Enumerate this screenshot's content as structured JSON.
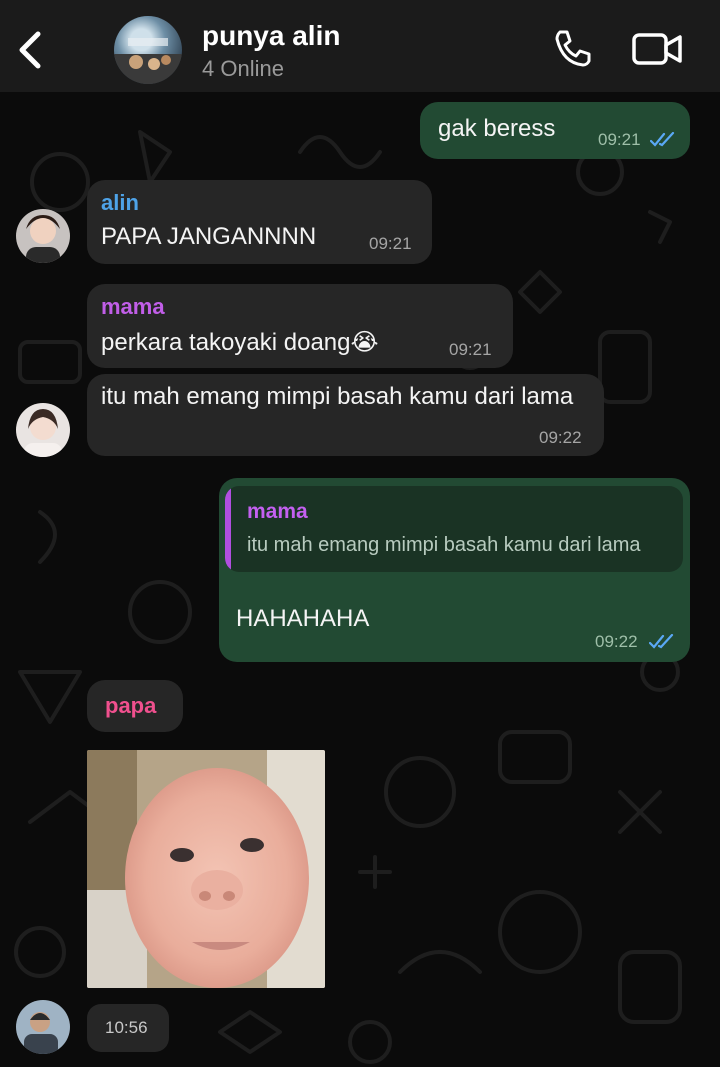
{
  "header": {
    "back_icon": "chevron-left-icon",
    "title": "punya alin",
    "status": "4 Online",
    "call_icon": "phone-icon",
    "video_icon": "video-camera-icon"
  },
  "colors": {
    "outgoing_bubble": "#224a33",
    "incoming_bubble": "#262626",
    "name_alin": "#4ea3e8",
    "name_mama": "#c15ee8",
    "name_papa": "#f0508e",
    "read_ticks": "#5aa8f5"
  },
  "messages": [
    {
      "direction": "out",
      "text": "gak beress",
      "time": "09:21"
    },
    {
      "direction": "in",
      "sender": "alin",
      "text": "PAPA JANGANNNN",
      "time": "09:21"
    },
    {
      "direction": "in",
      "sender": "mama",
      "text": "perkara takoyaki doang😭",
      "time": "09:21"
    },
    {
      "direction": "in",
      "text": "itu mah emang mimpi basah kamu dari lama",
      "time": "09:22"
    },
    {
      "direction": "out",
      "reply_to": {
        "sender": "mama",
        "text": "itu mah emang mimpi basah kamu dari lama"
      },
      "text": "HAHAHAHA",
      "time": "09:22"
    },
    {
      "direction": "in",
      "sender": "papa",
      "type": "photo",
      "time": "10:56"
    }
  ]
}
